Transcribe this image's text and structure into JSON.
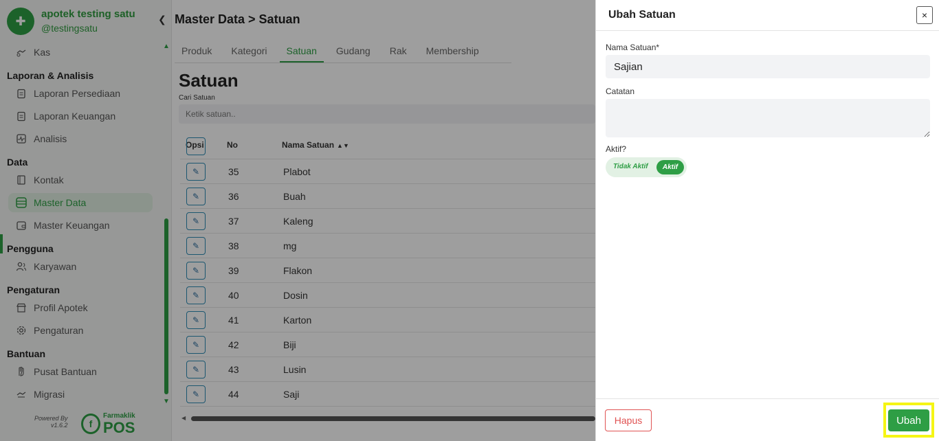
{
  "brand": {
    "name": "apotek testing satu",
    "handle": "@testingsatu"
  },
  "sidebar": {
    "items": [
      {
        "type": "item",
        "label": "Kas",
        "icon": "cash-icon"
      },
      {
        "type": "section",
        "label": "Laporan & Analisis"
      },
      {
        "type": "item",
        "label": "Laporan Persediaan",
        "icon": "clipboard-icon"
      },
      {
        "type": "item",
        "label": "Laporan Keuangan",
        "icon": "clipboard-icon"
      },
      {
        "type": "item",
        "label": "Analisis",
        "icon": "pulse-icon"
      },
      {
        "type": "section",
        "label": "Data"
      },
      {
        "type": "item",
        "label": "Kontak",
        "icon": "contact-book-icon"
      },
      {
        "type": "item",
        "label": "Master Data",
        "icon": "database-icon",
        "active": true
      },
      {
        "type": "item",
        "label": "Master Keuangan",
        "icon": "wallet-icon"
      },
      {
        "type": "section",
        "label": "Pengguna"
      },
      {
        "type": "item",
        "label": "Karyawan",
        "icon": "users-icon"
      },
      {
        "type": "section",
        "label": "Pengaturan"
      },
      {
        "type": "item",
        "label": "Profil Apotek",
        "icon": "store-icon"
      },
      {
        "type": "item",
        "label": "Pengaturan",
        "icon": "gear-icon"
      },
      {
        "type": "section",
        "label": "Bantuan"
      },
      {
        "type": "item",
        "label": "Pusat Bantuan",
        "icon": "hand-icon"
      },
      {
        "type": "item",
        "label": "Migrasi",
        "icon": "migrate-icon"
      }
    ],
    "powered_by": "Powered By",
    "version": "v1.6.2",
    "footer_logo_small": "Farmaklik",
    "footer_logo_big": "POS"
  },
  "header": {
    "breadcrumb": "Master Data > Satuan"
  },
  "tabs": [
    {
      "label": "Produk"
    },
    {
      "label": "Kategori"
    },
    {
      "label": "Satuan",
      "active": true
    },
    {
      "label": "Gudang"
    },
    {
      "label": "Rak"
    },
    {
      "label": "Membership"
    }
  ],
  "page": {
    "title": "Satuan",
    "search_label": "Cari Satuan",
    "search_placeholder": "Ketik satuan.."
  },
  "table": {
    "columns": {
      "opsi": "Opsi",
      "no": "No",
      "nama": "Nama Satuan"
    },
    "rows": [
      {
        "no": "35",
        "nama": "Plabot"
      },
      {
        "no": "36",
        "nama": "Buah"
      },
      {
        "no": "37",
        "nama": "Kaleng"
      },
      {
        "no": "38",
        "nama": "mg"
      },
      {
        "no": "39",
        "nama": "Flakon"
      },
      {
        "no": "40",
        "nama": "Dosin"
      },
      {
        "no": "41",
        "nama": "Karton"
      },
      {
        "no": "42",
        "nama": "Biji"
      },
      {
        "no": "43",
        "nama": "Lusin"
      },
      {
        "no": "44",
        "nama": "Saji"
      }
    ]
  },
  "drawer": {
    "title": "Ubah Satuan",
    "close_label": "×",
    "nama_label": "Nama Satuan*",
    "nama_value": "Sajian",
    "catatan_label": "Catatan",
    "catatan_value": "",
    "aktif_label": "Aktif?",
    "toggle_off_label": "Tidak Aktif",
    "toggle_on_label": "Aktif",
    "hapus_label": "Hapus",
    "ubah_label": "Ubah"
  },
  "colors": {
    "brand": "#2e9e45",
    "danger": "#e05252",
    "highlight": "#f5f514"
  }
}
